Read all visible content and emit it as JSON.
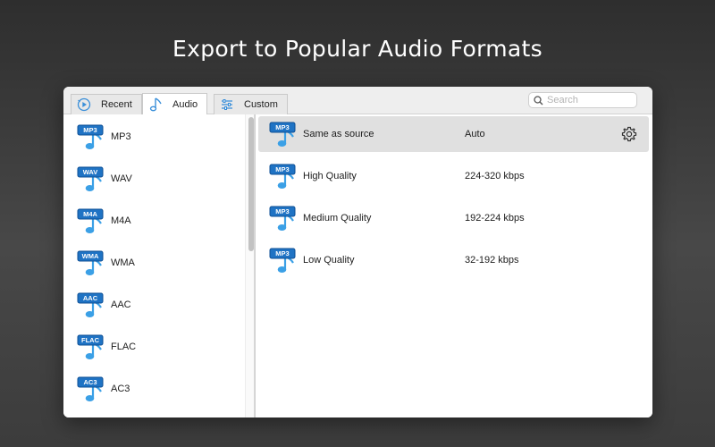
{
  "headline": "Export to Popular Audio Formats",
  "tabs": [
    {
      "label": "Recent",
      "icon": "play-circle-icon"
    },
    {
      "label": "Audio",
      "icon": "music-note-icon"
    },
    {
      "label": "Custom",
      "icon": "sliders-icon"
    }
  ],
  "active_tab": "Audio",
  "search": {
    "placeholder": "Search",
    "value": ""
  },
  "formats": [
    {
      "badge": "MP3",
      "label": "MP3"
    },
    {
      "badge": "WAV",
      "label": "WAV"
    },
    {
      "badge": "M4A",
      "label": "M4A"
    },
    {
      "badge": "WMA",
      "label": "WMA"
    },
    {
      "badge": "AAC",
      "label": "AAC"
    },
    {
      "badge": "FLAC",
      "label": "FLAC"
    },
    {
      "badge": "AC3",
      "label": "AC3"
    }
  ],
  "qualities": [
    {
      "badge": "MP3",
      "name": "Same as source",
      "rate": "Auto",
      "selected": true
    },
    {
      "badge": "MP3",
      "name": "High Quality",
      "rate": "224-320 kbps",
      "selected": false
    },
    {
      "badge": "MP3",
      "name": "Medium Quality",
      "rate": "192-224 kbps",
      "selected": false
    },
    {
      "badge": "MP3",
      "name": "Low Quality",
      "rate": "32-192 kbps",
      "selected": false
    }
  ],
  "colors": {
    "badge_blue": "#1f73c4",
    "note_blue": "#3ba0e6",
    "selected_row": "#e0e0e0"
  }
}
